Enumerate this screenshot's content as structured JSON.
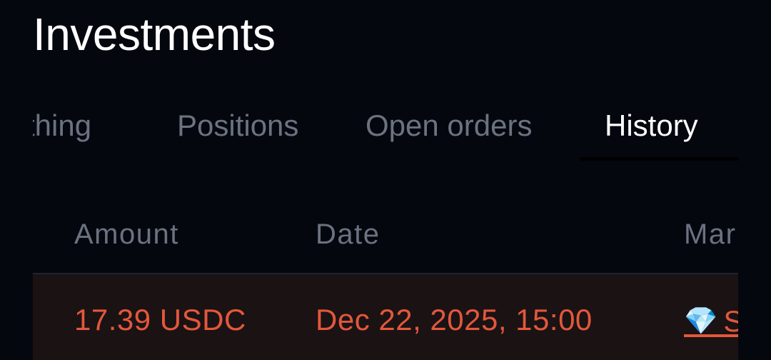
{
  "page": {
    "title": "Investments"
  },
  "tabs": [
    {
      "label": "ything",
      "active": false
    },
    {
      "label": "Positions",
      "active": false
    },
    {
      "label": "Open orders",
      "active": false
    },
    {
      "label": "History",
      "active": true
    }
  ],
  "table": {
    "columns": [
      "Amount",
      "Date",
      "Mar"
    ],
    "rows": [
      {
        "amount": "17.39 USDC",
        "date": "Dec 22, 2025, 15:00",
        "market_icon": "💎",
        "market_text": "S"
      }
    ]
  },
  "colors": {
    "background": "#05070f",
    "text_primary": "#ffffff",
    "text_muted": "#6b7280",
    "loss_red": "#e2583b",
    "row_highlight": "#1b1214"
  }
}
